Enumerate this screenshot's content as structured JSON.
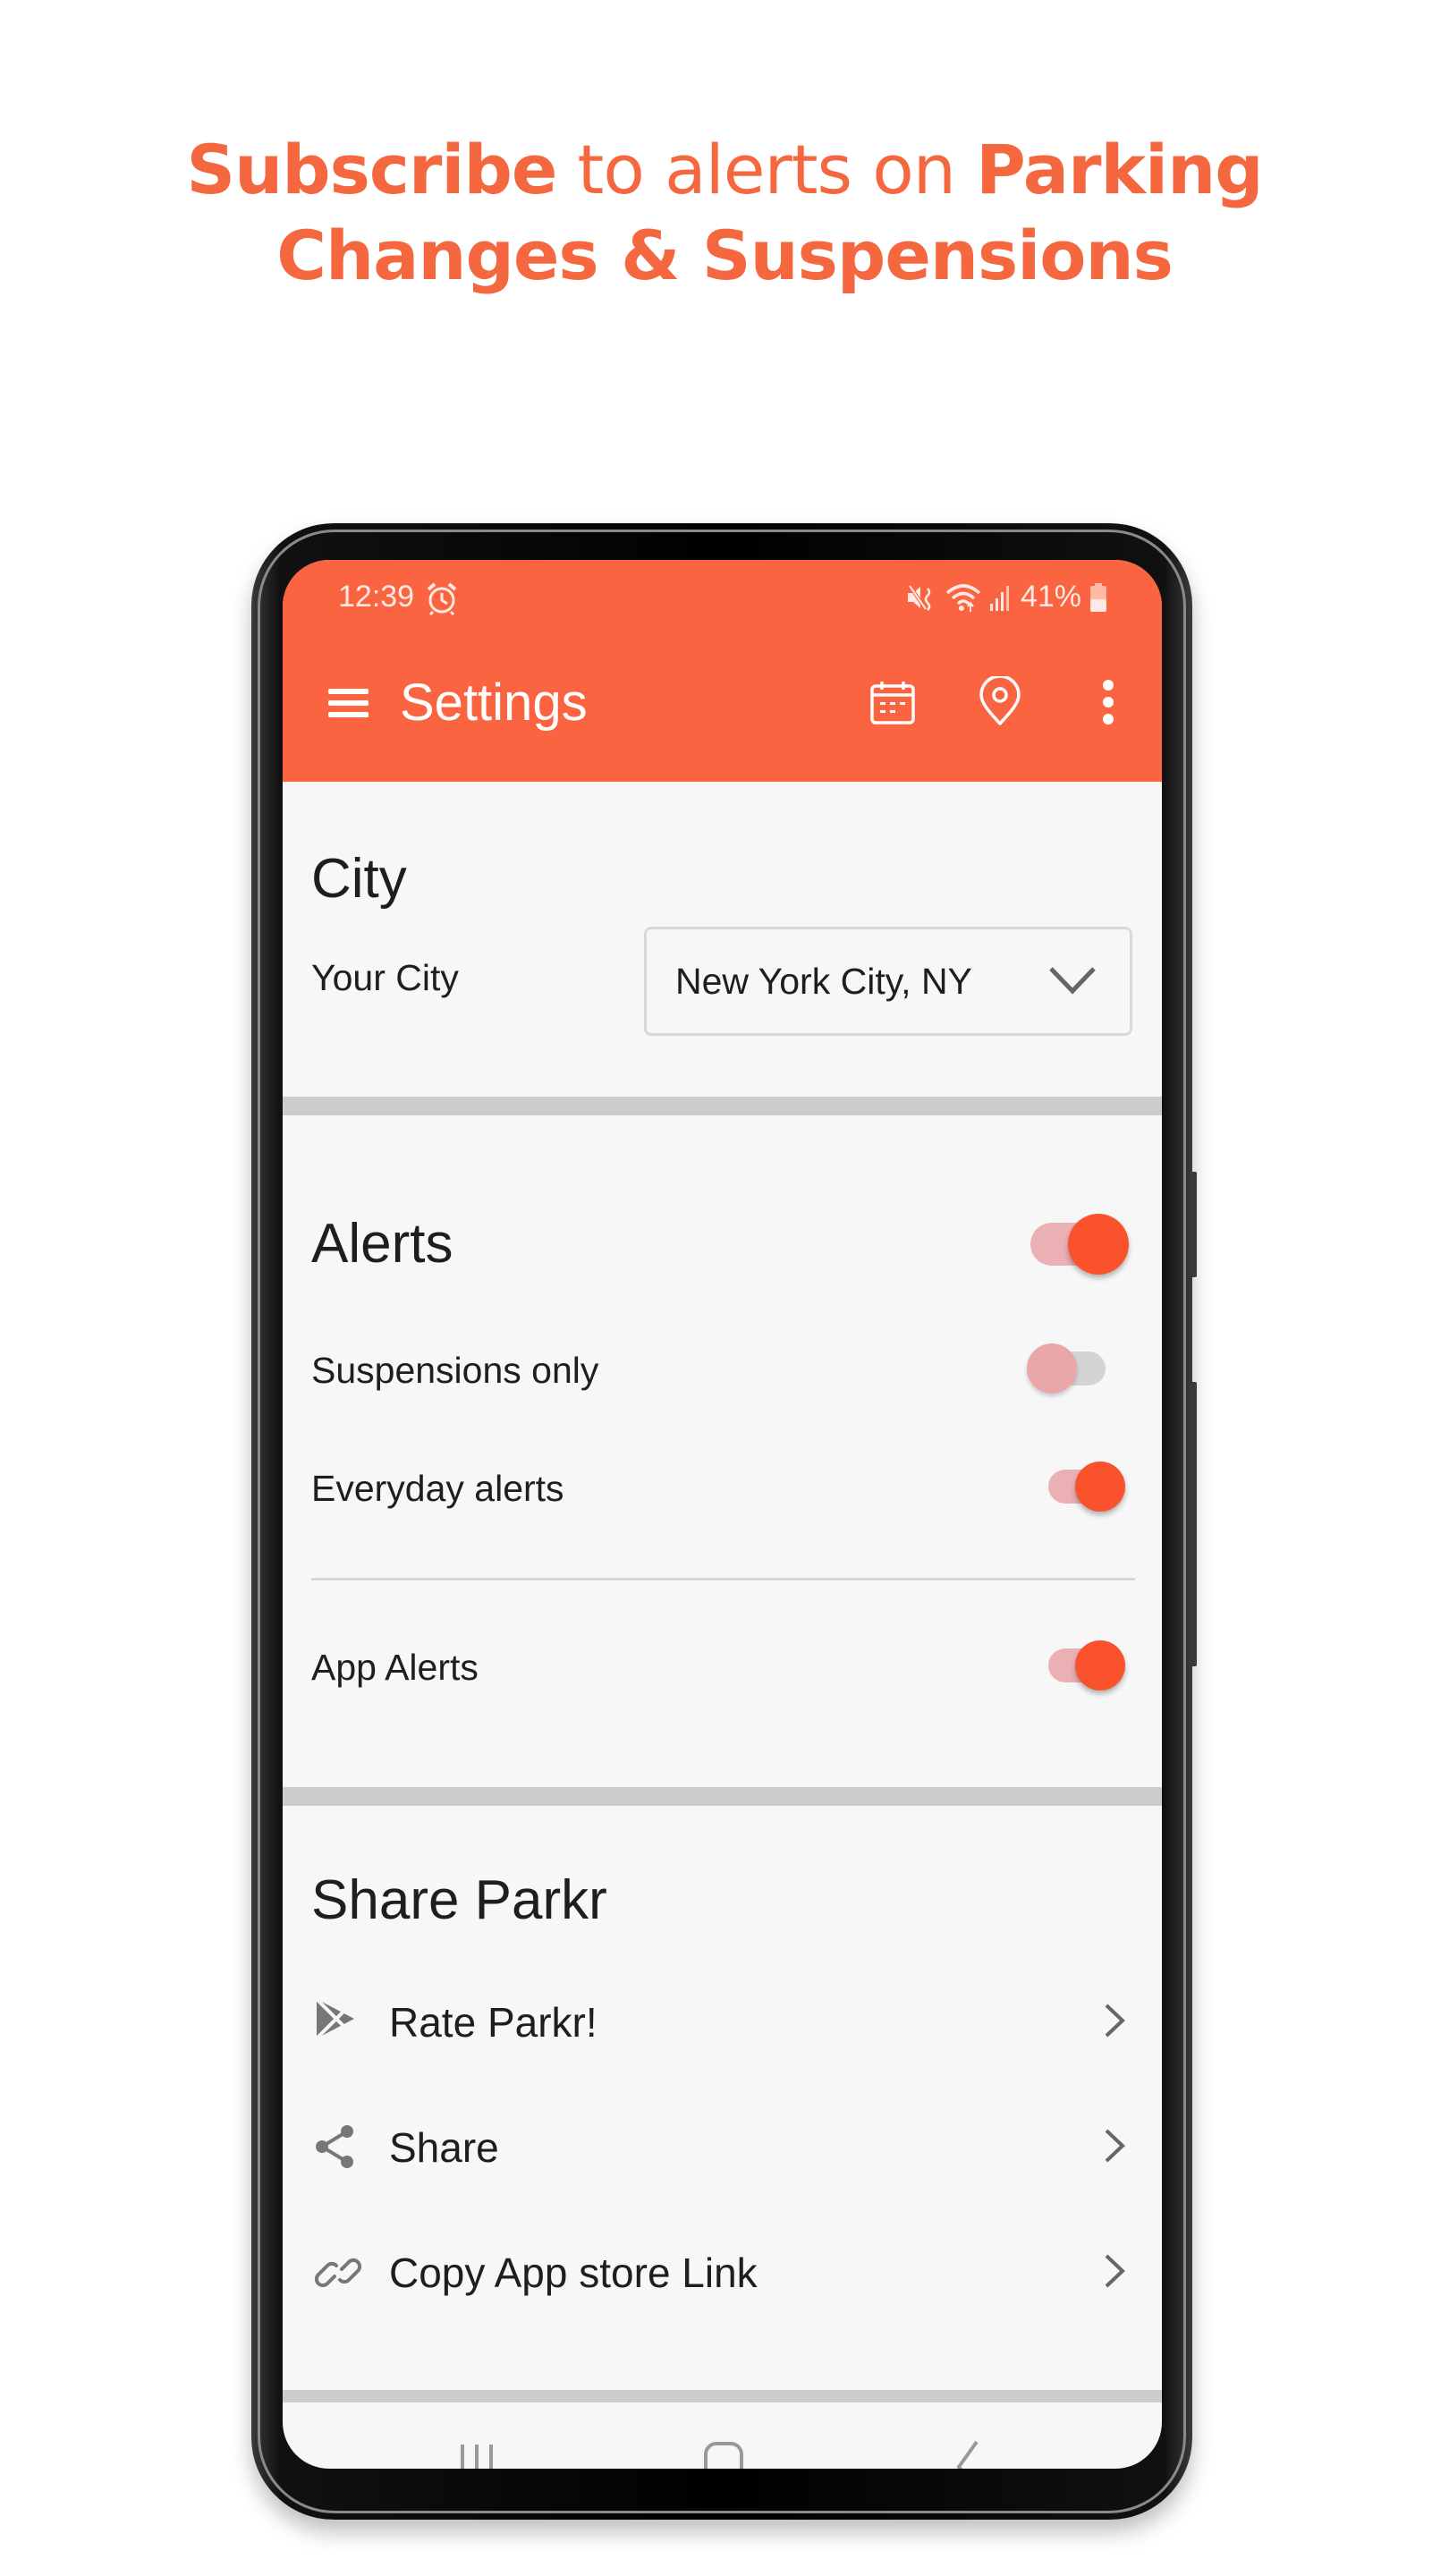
{
  "headline": {
    "line1": [
      {
        "text": "Subscribe",
        "bold": true
      },
      {
        "text": " to alerts on ",
        "bold": false
      },
      {
        "text": "Parking",
        "bold": true
      }
    ],
    "line2": [
      {
        "text": "Changes & Suspensions",
        "bold": true
      }
    ],
    "color": "#f4673f"
  },
  "status_bar": {
    "time": "12:39",
    "battery": "41%",
    "icons": [
      "alarm-icon",
      "mute-icon",
      "wifi-icon",
      "signal-icon",
      "battery-icon"
    ]
  },
  "app_bar": {
    "title": "Settings",
    "color": "#fb6441",
    "icons": [
      "menu-icon",
      "calendar-icon",
      "location-pin-icon",
      "more-vert-icon"
    ]
  },
  "city_section": {
    "title": "City",
    "your_city_label": "Your City",
    "selected_city": "New York City, NY"
  },
  "alerts_section": {
    "title": "Alerts",
    "master_enabled": true,
    "rows": [
      {
        "label": "Suspensions only",
        "enabled": false
      },
      {
        "label": "Everyday alerts",
        "enabled": true
      },
      {
        "label": "App Alerts",
        "enabled": true
      }
    ]
  },
  "share_section": {
    "title": "Share Parkr",
    "items": [
      {
        "label": "Rate Parkr!",
        "icon": "play-store-icon"
      },
      {
        "label": "Share",
        "icon": "share-icon"
      },
      {
        "label": "Copy App store Link",
        "icon": "link-icon"
      }
    ]
  },
  "nav_bar": {
    "buttons": [
      "recents-icon",
      "home-icon",
      "back-icon"
    ]
  },
  "colors": {
    "accent": "#fb6441",
    "toggle_on_thumb": "#f9522c",
    "toggle_on_track": "#eab0b3",
    "toggle_off_thumb": "#e9a7aa",
    "toggle_off_track": "#d4d4d4"
  }
}
